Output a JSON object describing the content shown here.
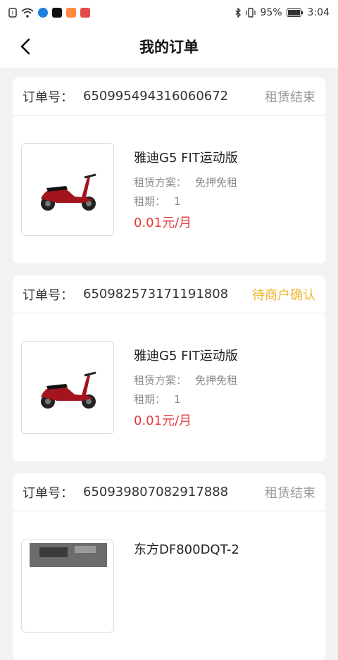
{
  "status_bar": {
    "battery": "95%",
    "time": "3:04"
  },
  "nav": {
    "title": "我的订单"
  },
  "labels": {
    "order_no": "订单号：",
    "plan": "租赁方案：",
    "term": "租期："
  },
  "colors": {
    "price": "#e23b3b",
    "status_done": "#9a9a9a",
    "status_pending": "#f0b62e"
  },
  "orders": [
    {
      "order_no": "650995494316060672",
      "status": "租赁结束",
      "status_type": "done",
      "product_name": "雅迪G5 FIT运动版",
      "plan": "免押免租",
      "term": "1",
      "price": "0.01元/月",
      "image": "red-scooter"
    },
    {
      "order_no": "650982573171191808",
      "status": "待商户确认",
      "status_type": "pending",
      "product_name": "雅迪G5 FIT运动版",
      "plan": "免押免租",
      "term": "1",
      "price": "0.01元/月",
      "image": "red-scooter"
    },
    {
      "order_no": "650939807082917888",
      "status": "租赁结束",
      "status_type": "done",
      "product_name": "东方DF800DQT-2",
      "plan": "",
      "term": "",
      "price": "",
      "image": "motorcycle"
    }
  ]
}
